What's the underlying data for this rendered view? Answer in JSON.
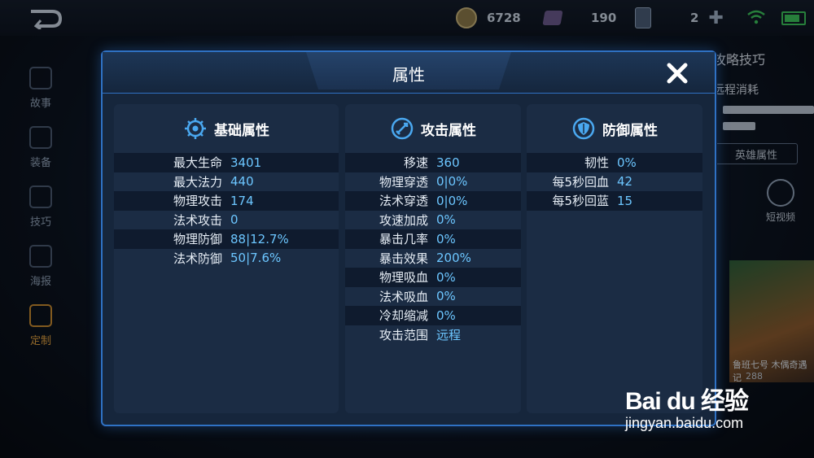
{
  "topbar": {
    "gold": "6728",
    "gems": "190",
    "cards": "2"
  },
  "side_nav": [
    {
      "label": "故事"
    },
    {
      "label": "装备"
    },
    {
      "label": "技巧"
    },
    {
      "label": "海报"
    },
    {
      "label": "定制"
    }
  ],
  "background_right": {
    "tips_title": "攻略技巧",
    "range_label": "远程消耗",
    "hero_attr_button": "英雄属性",
    "short_video": "短视频",
    "hero_name": "鲁班七号 木偶奇遇记",
    "hero_count": "288"
  },
  "modal": {
    "title": "属性",
    "basic": {
      "heading": "基础属性",
      "rows": [
        {
          "label": "最大生命",
          "value": "3401"
        },
        {
          "label": "最大法力",
          "value": "440"
        },
        {
          "label": "物理攻击",
          "value": "174"
        },
        {
          "label": "法术攻击",
          "value": "0"
        },
        {
          "label": "物理防御",
          "value": "88|12.7%"
        },
        {
          "label": "法术防御",
          "value": "50|7.6%"
        }
      ]
    },
    "attack": {
      "heading": "攻击属性",
      "rows": [
        {
          "label": "移速",
          "value": "360"
        },
        {
          "label": "物理穿透",
          "value": "0|0%"
        },
        {
          "label": "法术穿透",
          "value": "0|0%"
        },
        {
          "label": "攻速加成",
          "value": "0%"
        },
        {
          "label": "暴击几率",
          "value": "0%"
        },
        {
          "label": "暴击效果",
          "value": "200%"
        },
        {
          "label": "物理吸血",
          "value": "0%"
        },
        {
          "label": "法术吸血",
          "value": "0%"
        },
        {
          "label": "冷却缩减",
          "value": "0%"
        },
        {
          "label": "攻击范围",
          "value": "远程"
        }
      ]
    },
    "defense": {
      "heading": "防御属性",
      "rows": [
        {
          "label": "韧性",
          "value": "0%"
        },
        {
          "label": "每5秒回血",
          "value": "42"
        },
        {
          "label": "每5秒回蓝",
          "value": "15"
        }
      ]
    }
  },
  "watermark": {
    "logo": "Bai du 经验",
    "url": "jingyan.baidu.com"
  }
}
